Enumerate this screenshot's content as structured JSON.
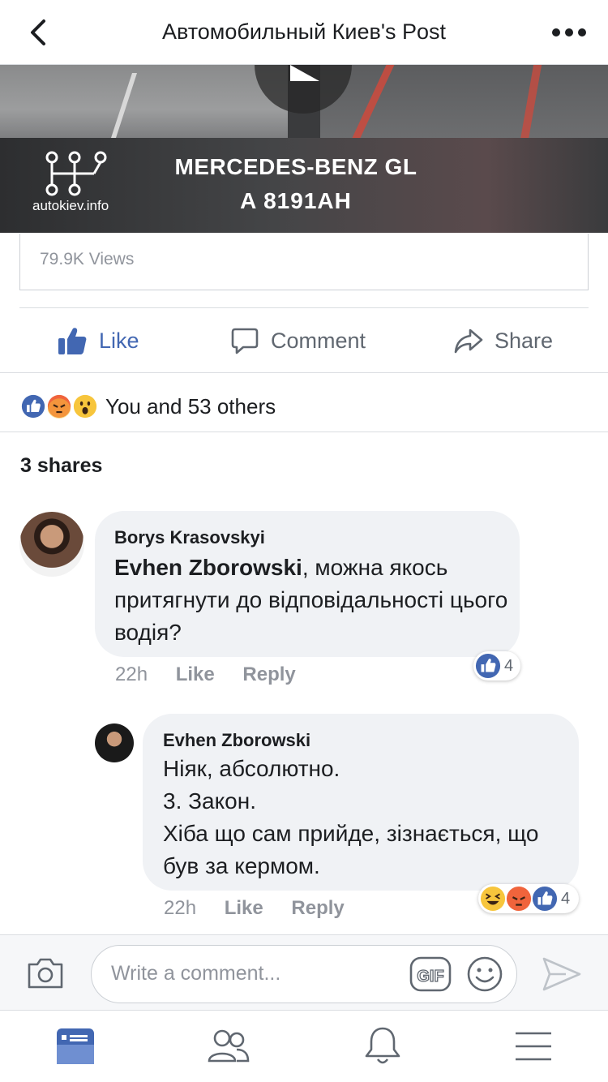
{
  "header": {
    "title": "Автомобильный Киев's Post"
  },
  "video": {
    "logo_text": "autokiev.info",
    "model": "MERCEDES-BENZ GL",
    "plate": "A 8191AH",
    "views": "79.9K Views"
  },
  "actions": {
    "like": "Like",
    "comment": "Comment",
    "share": "Share"
  },
  "reactions": {
    "summary": "You and 53 others"
  },
  "shares": "3 shares",
  "comments": [
    {
      "author": "Borys Krasovskyi",
      "mention": "Evhen Zborowski",
      "text": ", можна якось притягнути до відповідальності цього водія?",
      "time": "22h",
      "like_label": "Like",
      "reply_label": "Reply",
      "reaction_count": "4"
    },
    {
      "author": "Evhen Zborowski",
      "lines": [
        "Ніяк, абсолютно.",
        "3. Закон.",
        "Хіба що сам прийде, зізнається, що був за кермом."
      ],
      "time": "22h",
      "like_label": "Like",
      "reply_label": "Reply",
      "reaction_count": "4"
    }
  ],
  "composer": {
    "placeholder": "Write a comment...",
    "gif_label": "GIF"
  },
  "colors": {
    "brand": "#4267b2",
    "angry": "#f0643c",
    "wow": "#f7c53c"
  }
}
